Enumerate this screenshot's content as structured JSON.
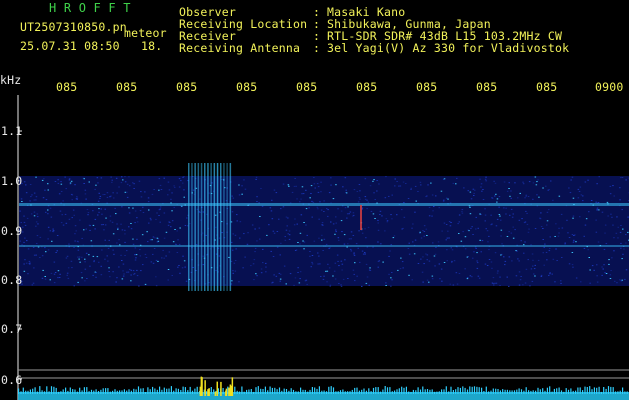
{
  "header": {
    "app_name": "H R O F F T",
    "filename": "UT2507310850.pn",
    "event_label": "meteor",
    "datetime": "25.07.31 08:50",
    "count": "18.",
    "observer_label": "Observer",
    "location_label": "Receiving Location",
    "receiver_label": "Receiver",
    "antenna_label": "Receiving Antenna",
    "sep": ":",
    "observer_value": "Masaki Kano",
    "location_value": "Shibukawa, Gunma, Japan",
    "receiver_value": "RTL-SDR SDR# 43dB L15 103.2MHz CW",
    "antenna_value": "3el Yagi(V) Az 330 for Vladivostok"
  },
  "time_axis": {
    "labels": [
      "085",
      "085",
      "085",
      "085",
      "085",
      "085",
      "085",
      "085",
      "085",
      "0900"
    ]
  },
  "freq_axis": {
    "unit": "kHz",
    "labels": [
      "1.1",
      "1.0",
      "0.9",
      "0.8",
      "0.7",
      "0.6"
    ]
  },
  "colors": {
    "background": "#000000",
    "header_green": "#3fd24a",
    "time_labels": "#f2f25a",
    "axis_white": "#e8e8e8",
    "signal_blue": "#1e3cc8",
    "signal_cyan": "#3cc8ff",
    "meteor_yellow": "#f0e020"
  }
}
